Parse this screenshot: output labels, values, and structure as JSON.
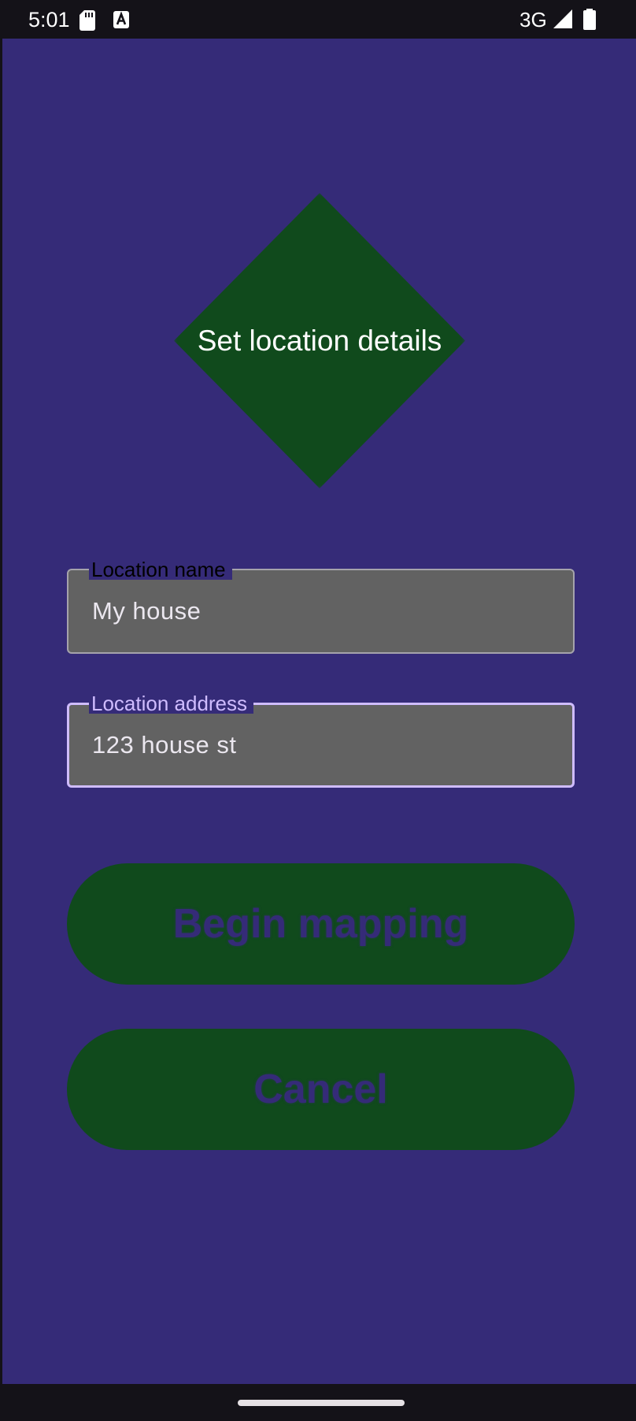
{
  "status_bar": {
    "time": "5:01",
    "network": "3G",
    "icons": [
      "sd-card-icon",
      "accessibility-a-icon",
      "signal-icon",
      "battery-icon"
    ]
  },
  "header": {
    "title": "Set location details"
  },
  "form": {
    "location_name": {
      "label": "Location name",
      "value": "My house"
    },
    "location_address": {
      "label": "Location address",
      "value": "123 house st"
    }
  },
  "buttons": {
    "begin_label": "Begin mapping",
    "cancel_label": "Cancel"
  },
  "colors": {
    "background": "#352b78",
    "accent_green": "#104a1c",
    "field_fill": "#626262",
    "focus_outline": "#cfbcff",
    "system_bars": "#141218"
  }
}
